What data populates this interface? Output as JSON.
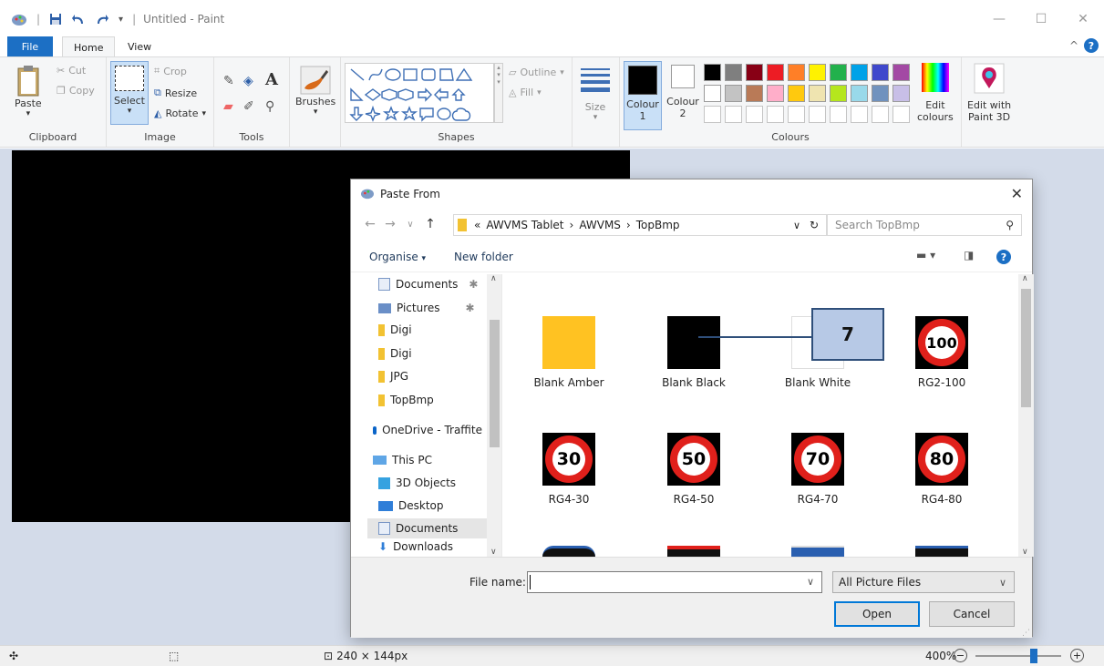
{
  "window": {
    "title": "Untitled - Paint"
  },
  "ribbon": {
    "tabs": [
      "File",
      "Home",
      "View"
    ],
    "clipboard": {
      "paste": "Paste",
      "cut": "Cut",
      "copy": "Copy",
      "label": "Clipboard"
    },
    "image": {
      "select": "Select",
      "crop": "Crop",
      "resize": "Resize",
      "rotate": "Rotate",
      "label": "Image"
    },
    "tools": {
      "label": "Tools"
    },
    "brushes": {
      "label": "Brushes"
    },
    "shapes": {
      "outline": "Outline",
      "fill": "Fill",
      "label": "Shapes"
    },
    "size": {
      "label": "Size"
    },
    "colours": {
      "colour1": "Colour",
      "colour1_num": "1",
      "colour2": "Colour",
      "colour2_num": "2",
      "edit": "Edit",
      "edit2": "colours",
      "label": "Colours",
      "palette_row1": [
        "#000000",
        "#7f7f7f",
        "#880015",
        "#ed1c24",
        "#ff7f27",
        "#fff200",
        "#22b14c",
        "#00a2e8",
        "#3f48cc",
        "#a349a4"
      ],
      "palette_row2": [
        "#ffffff",
        "#c3c3c3",
        "#b97a57",
        "#ffaec9",
        "#ffc90e",
        "#efe4b0",
        "#b5e61d",
        "#99d9ea",
        "#7092be",
        "#c8bfe7"
      ]
    },
    "paint3d": {
      "line1": "Edit with",
      "line2": "Paint 3D"
    }
  },
  "status": {
    "dimensions": "240 × 144px",
    "zoom": "400%"
  },
  "dialog": {
    "title": "Paste From",
    "breadcrumb": [
      "AWVMS Tablet",
      "AWVMS",
      "TopBmp"
    ],
    "breadcrumb_prefix": "«",
    "search_placeholder": "Search TopBmp",
    "organise": "Organise",
    "new_folder": "New folder",
    "nav_items": [
      "Documents",
      "Pictures",
      "Digi",
      "Digi",
      "JPG",
      "TopBmp",
      "OneDrive - Traffite",
      "This PC",
      "3D Objects",
      "Desktop",
      "Documents",
      "Downloads"
    ],
    "files": [
      {
        "name": "Blank Amber",
        "color": "#ffc222"
      },
      {
        "name": "Blank Black",
        "color": "#000000"
      },
      {
        "name": "Blank White",
        "color": "#ffffff"
      },
      {
        "name": "RG2-100",
        "sign": "100"
      },
      {
        "name": "RG4-30",
        "sign": "30"
      },
      {
        "name": "RG4-50",
        "sign": "50"
      },
      {
        "name": "RG4-70",
        "sign": "70"
      },
      {
        "name": "RG4-80",
        "sign": "80"
      }
    ],
    "file_name_label": "File name:",
    "file_name_value": "",
    "file_type": "All Picture Files",
    "open": "Open",
    "cancel": "Cancel"
  },
  "callout": {
    "number": "7"
  }
}
